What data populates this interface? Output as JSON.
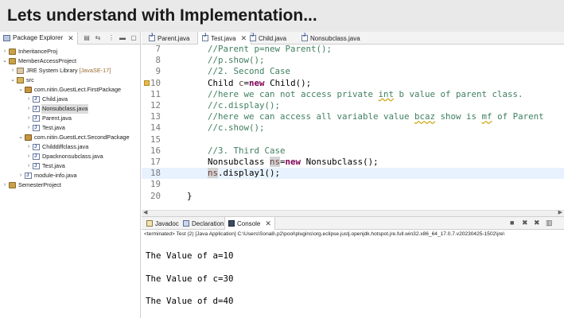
{
  "slide": {
    "title": "Lets understand with Implementation..."
  },
  "package_explorer": {
    "tab_label": "Package Explorer",
    "tree": [
      {
        "label": "InheritanceProj",
        "level": 0,
        "expanded": false,
        "icon": "project-icon"
      },
      {
        "label": "MemberAccessProject",
        "level": 0,
        "expanded": true,
        "icon": "project-icon"
      },
      {
        "label": "JRE System Library",
        "suffix": "[JavaSE-17]",
        "level": 1,
        "expanded": false,
        "icon": "library-icon"
      },
      {
        "label": "src",
        "level": 1,
        "expanded": true,
        "icon": "source-folder-icon"
      },
      {
        "label": "com.nitin.GuestLect.FirstPackage",
        "level": 2,
        "expanded": true,
        "icon": "package-icon"
      },
      {
        "label": "Child.java",
        "level": 3,
        "expanded": false,
        "icon": "java-file-icon"
      },
      {
        "label": "Nonsubclass.java",
        "level": 3,
        "expanded": false,
        "icon": "java-file-icon",
        "selected": true
      },
      {
        "label": "Parent.java",
        "level": 3,
        "expanded": false,
        "icon": "java-file-icon"
      },
      {
        "label": "Test.java",
        "level": 3,
        "expanded": false,
        "icon": "java-file-icon"
      },
      {
        "label": "com.nitin.GuestLect.SecondPackage",
        "level": 2,
        "expanded": true,
        "icon": "package-icon"
      },
      {
        "label": "Childdiffclass.java",
        "level": 3,
        "expanded": false,
        "icon": "java-file-icon"
      },
      {
        "label": "Dpacknonsubclass.java",
        "level": 3,
        "expanded": false,
        "icon": "java-file-icon"
      },
      {
        "label": "Test.java",
        "level": 3,
        "expanded": false,
        "icon": "java-file-icon"
      },
      {
        "label": "module-info.java",
        "level": 2,
        "expanded": false,
        "icon": "java-file-icon"
      },
      {
        "label": "SemesterProject",
        "level": 0,
        "expanded": false,
        "icon": "project-icon"
      }
    ]
  },
  "editor": {
    "tabs": [
      {
        "label": "Parent.java",
        "active": false
      },
      {
        "label": "Test.java",
        "active": true
      },
      {
        "label": "Child.java",
        "active": false
      },
      {
        "label": "Nonsubclass.java",
        "active": false
      }
    ],
    "lines": [
      {
        "n": "7",
        "tokens": [
          {
            "t": "//Parent p=new Parent();",
            "c": "comment"
          }
        ]
      },
      {
        "n": "8",
        "tokens": [
          {
            "t": "//p.show();",
            "c": "comment"
          }
        ]
      },
      {
        "n": "9",
        "tokens": [
          {
            "t": "//2. Second Case",
            "c": "comment"
          }
        ]
      },
      {
        "n": "10",
        "tokens": [
          {
            "t": "Child ",
            "c": "plain"
          },
          {
            "t": "c",
            "c": "local"
          },
          {
            "t": "=",
            "c": "plain"
          },
          {
            "t": "new",
            "c": "keyword"
          },
          {
            "t": " Child();",
            "c": "plain"
          }
        ],
        "marker": true
      },
      {
        "n": "11",
        "tokens": [
          {
            "t": "//here we can not access private ",
            "c": "comment"
          },
          {
            "t": "int",
            "c": "comment-squiggle"
          },
          {
            "t": " b value of parent class.",
            "c": "comment"
          }
        ]
      },
      {
        "n": "12",
        "tokens": [
          {
            "t": "//c.display();",
            "c": "comment"
          }
        ]
      },
      {
        "n": "13",
        "tokens": [
          {
            "t": "//here we can access all variable value ",
            "c": "comment"
          },
          {
            "t": "bcaz",
            "c": "comment-squiggle"
          },
          {
            "t": " show is ",
            "c": "comment"
          },
          {
            "t": "mf",
            "c": "comment-squiggle"
          },
          {
            "t": " of Parent",
            "c": "comment"
          }
        ]
      },
      {
        "n": "14",
        "tokens": [
          {
            "t": "//c.show();",
            "c": "comment"
          }
        ]
      },
      {
        "n": "15",
        "tokens": []
      },
      {
        "n": "16",
        "tokens": [
          {
            "t": "//3. Third Case",
            "c": "comment"
          }
        ]
      },
      {
        "n": "17",
        "tokens": [
          {
            "t": "Nonsubclass ",
            "c": "plain"
          },
          {
            "t": "ns",
            "c": "marked"
          },
          {
            "t": "=",
            "c": "plain"
          },
          {
            "t": "new",
            "c": "keyword"
          },
          {
            "t": " Nonsubclass();",
            "c": "plain"
          }
        ]
      },
      {
        "n": "18",
        "tokens": [
          {
            "t": "ns",
            "c": "marked"
          },
          {
            "t": ".display1();",
            "c": "plain"
          }
        ],
        "current": true
      },
      {
        "n": "19",
        "tokens": []
      },
      {
        "n": "20",
        "tokens": [
          {
            "t": "}",
            "c": "plain"
          }
        ],
        "indent": "outer"
      }
    ]
  },
  "console": {
    "tabs": [
      {
        "label": "Javadoc",
        "active": false,
        "icon": "javadoc-icon"
      },
      {
        "label": "Declaration",
        "active": false,
        "icon": "declaration-icon"
      },
      {
        "label": "Console",
        "active": true,
        "icon": "console-icon"
      }
    ],
    "terminated_text": "<terminated> Test (2) [Java Application] C:\\Users\\Sonali\\.p2\\pool\\plugins\\org.eclipse.justj.openjdk.hotspot.jre.full.win32.x86_64_17.0.7.v20230425-1502\\jre\\",
    "output": [
      "The Value of a=10",
      "",
      "The Value of c=30",
      "",
      "The Value of d=40"
    ]
  },
  "colors": {
    "comment": "#3f7f5f",
    "keyword": "#7f0055",
    "local_variable": "#6a3e3e",
    "current_line": "#e8f2fe",
    "title_bar": "#e9e9e9"
  }
}
